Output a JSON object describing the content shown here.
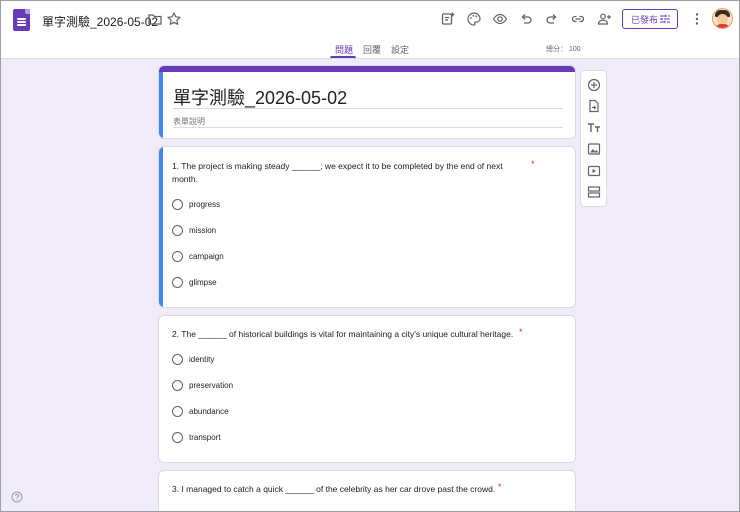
{
  "header": {
    "title": "單字測驗_2026-05-02",
    "publish_label": "已發布",
    "icons": [
      "forms-logo-icon",
      "folder-icon",
      "star-icon",
      "addon-icon",
      "palette-icon",
      "preview-eye-icon",
      "undo-icon",
      "redo-icon",
      "link-icon",
      "add-collaborator-icon",
      "tune-icon",
      "more-vert-icon",
      "avatar"
    ]
  },
  "tabs": [
    {
      "label": "問題",
      "active": true
    },
    {
      "label": "回覆",
      "active": false
    },
    {
      "label": "設定",
      "active": false
    }
  ],
  "score": "總分： 100",
  "form": {
    "title": "單字測驗_2026-05-02",
    "description": "表單說明"
  },
  "questions": [
    {
      "text_line1": "1. The project is making steady ______; we expect it to be completed by the end of next",
      "text_line2": "month.",
      "required_mark": "*",
      "options": [
        "progress",
        "mission",
        "campaign",
        "glimpse"
      ]
    },
    {
      "text": "2. The ______ of historical buildings is vital for maintaining a city's unique cultural heritage.",
      "required_mark": "*",
      "options": [
        "identity",
        "preservation",
        "abundance",
        "transport"
      ]
    },
    {
      "text": "3. I managed to catch a quick ______ of the celebrity as her car drove past the crowd.",
      "required_mark": "*",
      "options": []
    }
  ],
  "side_toolbar": [
    "add-question-icon",
    "import-questions-icon",
    "add-title-icon",
    "add-image-icon",
    "add-video-icon",
    "add-section-icon"
  ],
  "colors": {
    "accent": "#673ab7",
    "focus": "#4285f4",
    "background": "#f0ebf8",
    "required": "#d93025"
  }
}
